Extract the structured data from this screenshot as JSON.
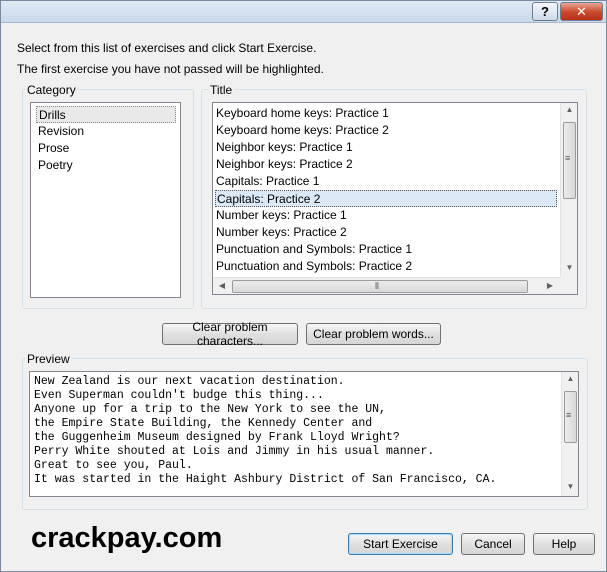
{
  "window": {
    "help_glyph": "?",
    "close_glyph": "✕"
  },
  "instructions": {
    "line1": "Select from this list of exercises and click Start Exercise.",
    "line2": "The first exercise you have not passed will be highlighted."
  },
  "category": {
    "label": "Category",
    "items": [
      "Drills",
      "Revision",
      "Prose",
      "Poetry"
    ],
    "selected_index": 0
  },
  "title": {
    "label": "Title",
    "items": [
      "Keyboard home keys: Practice 1",
      "Keyboard home keys: Practice 2",
      "Neighbor keys: Practice 1",
      "Neighbor keys: Practice 2",
      "Capitals: Practice 1",
      "Capitals: Practice 2",
      "Number keys: Practice 1",
      "Number keys: Practice 2",
      "Punctuation and Symbols: Practice 1",
      "Punctuation and Symbols: Practice 2"
    ],
    "selected_index": 5
  },
  "problem_buttons": {
    "characters": "Clear problem characters...",
    "words": "Clear problem words..."
  },
  "preview": {
    "label": "Preview",
    "lines": [
      "New Zealand is our next vacation destination.",
      "Even Superman couldn't budge this thing...",
      "Anyone up for a trip to the New York to see the UN,",
      "the Empire State Building, the Kennedy Center and",
      "the Guggenheim Museum designed by Frank Lloyd Wright?",
      "Perry White shouted at Lois and Jimmy in his usual manner.",
      "Great to see you, Paul.",
      "It was started in the Haight Ashbury District of San Francisco, CA."
    ]
  },
  "watermark": "crackpay.com",
  "footer": {
    "start": "Start Exercise",
    "cancel": "Cancel",
    "help": "Help"
  },
  "icons": {
    "up_arrow": "▲",
    "down_arrow": "▼",
    "left_arrow": "◀",
    "right_arrow": "▶",
    "grip_v": "≡",
    "grip_h": "⦀"
  }
}
